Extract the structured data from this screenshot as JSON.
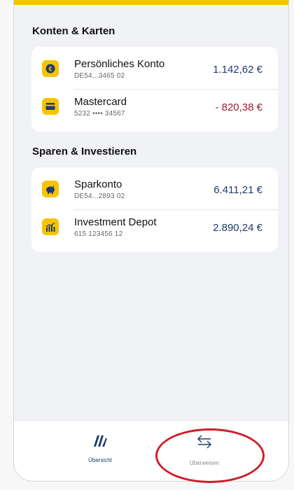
{
  "colors": {
    "accent": "#f5c400",
    "amount_positive": "#1f3a6e",
    "amount_negative": "#9a1b2f",
    "highlight": "#cc1f2c"
  },
  "sections": [
    {
      "title": "Konten & Karten",
      "items": [
        {
          "name": "Persönliches Konto",
          "sub": "DE54...3465 02",
          "amount": "1.142,62 €",
          "icon": "euro-icon"
        },
        {
          "name": "Mastercard",
          "sub": "5232 •••• 34567",
          "amount": "- 820,38 €",
          "icon": "credit-card-icon"
        }
      ]
    },
    {
      "title": "Sparen & Investieren",
      "items": [
        {
          "name": "Sparkonto",
          "sub": "DE54...2893 02",
          "amount": "6.411,21 €",
          "icon": "piggy-bank-icon"
        },
        {
          "name": "Investment Depot",
          "sub": "615 123456 12",
          "amount": "2.890,24 €",
          "icon": "bar-chart-icon"
        }
      ]
    }
  ],
  "tabbar": {
    "overview": {
      "label": "Übersicht",
      "icon": "overview-icon"
    },
    "transfer": {
      "label": "Überweisen",
      "icon": "transfer-arrows-icon"
    }
  }
}
